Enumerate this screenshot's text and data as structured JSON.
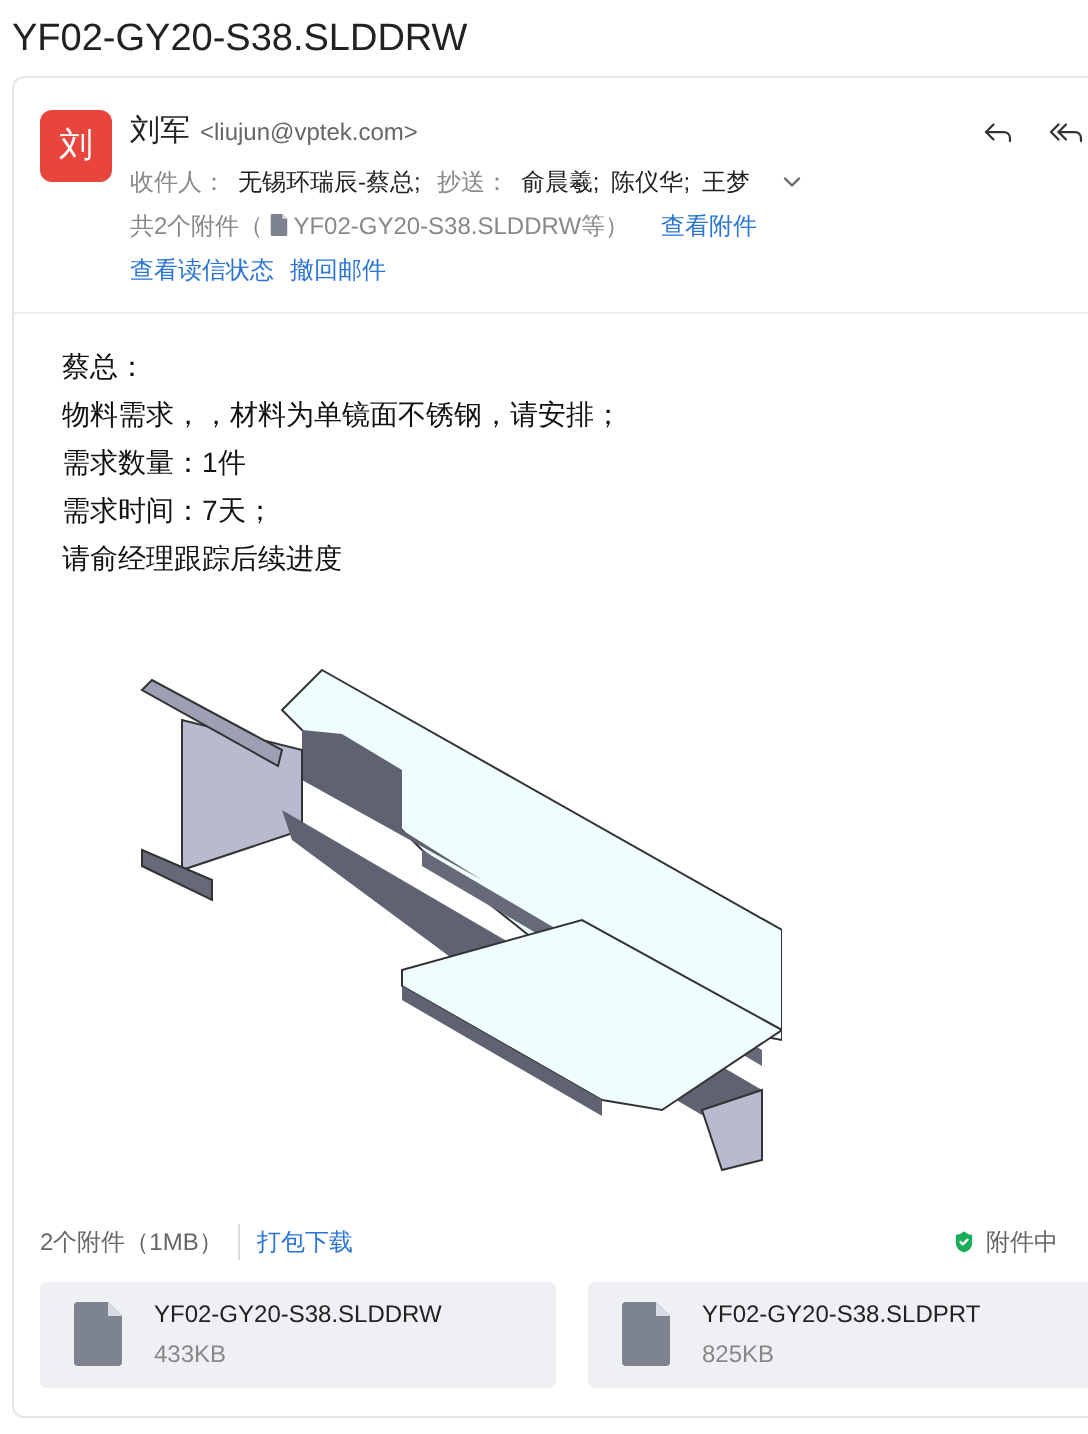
{
  "page_title": "YF02-GY20-S38.SLDDRW",
  "sender": {
    "avatar": "刘",
    "name": "刘军",
    "email": "<liujun@vptek.com>"
  },
  "recipients": {
    "to_label": "收件人：",
    "to": [
      "无锡环瑞辰-蔡总;"
    ],
    "cc_label": "抄送：",
    "cc": [
      "俞晨羲;",
      "陈仪华;",
      "王梦"
    ]
  },
  "attachment_summary": {
    "prefix": "共2个附件（",
    "file": "YF02-GY20-S38.SLDDRW等）",
    "link": "查看附件"
  },
  "actions": [
    "查看读信状态",
    "撤回邮件"
  ],
  "body": [
    "蔡总：",
    "物料需求，，材料为单镜面不锈钢，请安排；",
    "需求数量：1件",
    "需求时间：7天；",
    "请俞经理跟踪后续进度"
  ],
  "footer": {
    "count": "2个附件（1MB）",
    "download": "打包下载",
    "notice": "附件中"
  },
  "attachments": [
    {
      "name": "YF02-GY20-S38.SLDDRW",
      "size": "433KB"
    },
    {
      "name": "YF02-GY20-S38.SLDPRT",
      "size": "825KB"
    }
  ]
}
